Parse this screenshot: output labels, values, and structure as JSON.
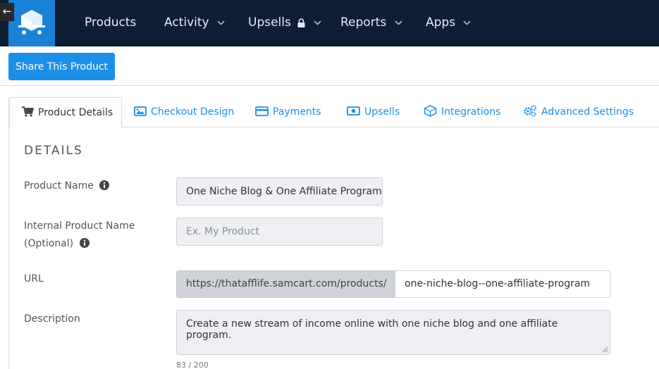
{
  "nav": {
    "items": [
      {
        "label": "Products",
        "has_chevron": false
      },
      {
        "label": "Activity",
        "has_chevron": true
      },
      {
        "label": "Upsells",
        "has_chevron": true,
        "locked": true
      },
      {
        "label": "Reports",
        "has_chevron": true
      },
      {
        "label": "Apps",
        "has_chevron": true
      }
    ],
    "back_glyph": "←",
    "bg_color": "#0e1e34",
    "logo_color": "#1a82d6"
  },
  "share_button": {
    "label": "Share This Product",
    "color": "#1b8fe8"
  },
  "tabs": [
    {
      "label": "Product Details",
      "icon": "cart-icon",
      "active": true
    },
    {
      "label": "Checkout Design",
      "icon": "image-icon",
      "active": false
    },
    {
      "label": "Payments",
      "icon": "credit-card-icon",
      "active": false
    },
    {
      "label": "Upsells",
      "icon": "money-icon",
      "active": false
    },
    {
      "label": "Integrations",
      "icon": "integrations-icon",
      "active": false
    },
    {
      "label": "Advanced Settings",
      "icon": "gears-icon",
      "active": false
    }
  ],
  "details": {
    "section_title": "DETAILS",
    "product_name": {
      "label": "Product Name",
      "value": "One Niche Blog & One Affiliate Program"
    },
    "internal_name": {
      "label_line1": "Internal Product Name",
      "label_line2": "(Optional)",
      "placeholder": "Ex. My Product"
    },
    "url": {
      "label": "URL",
      "prefix": "https://thatafflife.samcart.com/products/",
      "slug": "one-niche-blog--one-affiliate-program"
    },
    "description": {
      "label": "Description",
      "value": "Create a new stream of income online with one niche blog and one affiliate program.",
      "counter": "83 / 200"
    }
  }
}
